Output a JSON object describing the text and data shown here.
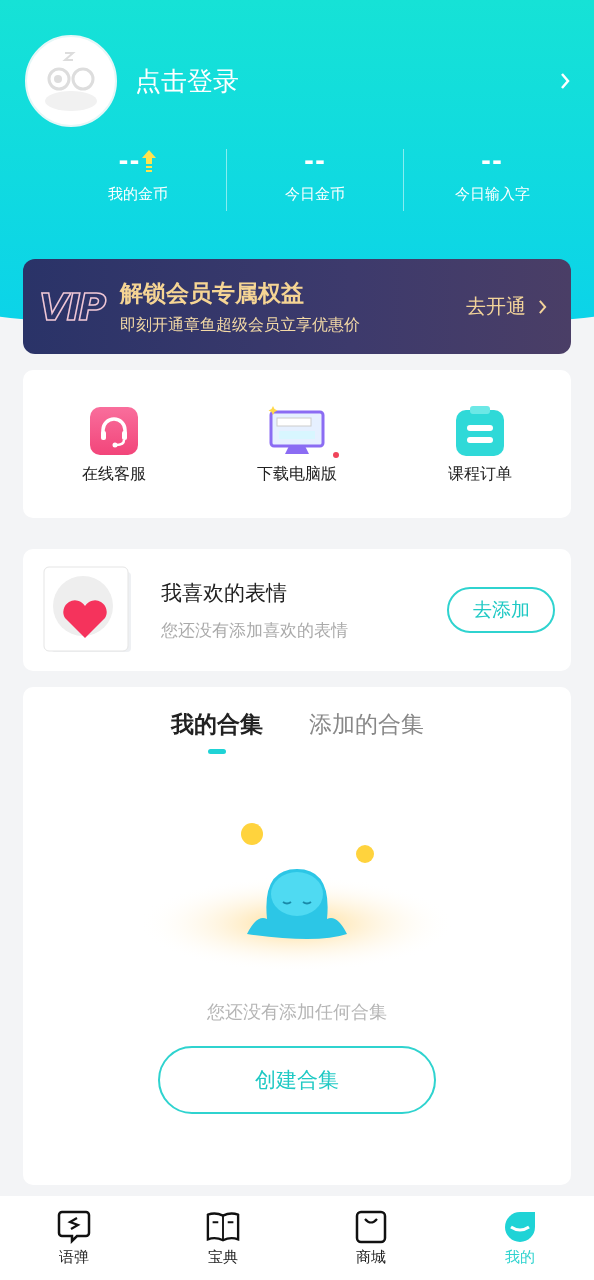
{
  "profile": {
    "login_text": "点击登录"
  },
  "stats": [
    {
      "value": "--",
      "label": "我的金币",
      "up_icon": true
    },
    {
      "value": "--",
      "label": "今日金币",
      "up_icon": false
    },
    {
      "value": "--",
      "label": "今日输入字",
      "up_icon": false
    }
  ],
  "vip": {
    "logo": "VIP",
    "title": "解锁会员专属权益",
    "subtitle": "即刻开通章鱼超级会员立享优惠价",
    "action": "去开通"
  },
  "quick_actions": [
    {
      "label": "在线客服",
      "kind": "headset",
      "dot": false
    },
    {
      "label": "下载电脑版",
      "kind": "monitor",
      "dot": true
    },
    {
      "label": "课程订单",
      "kind": "clipboard",
      "dot": false
    }
  ],
  "favorites": {
    "title": "我喜欢的表情",
    "subtitle": "您还没有添加喜欢的表情",
    "button": "去添加"
  },
  "collections": {
    "tabs": [
      {
        "label": "我的合集",
        "selected": true
      },
      {
        "label": "添加的合集",
        "selected": false
      }
    ],
    "empty_text": "您还没有添加任何合集",
    "button": "创建合集"
  },
  "nav": [
    {
      "label": "语弹",
      "kind": "chat",
      "selected": false
    },
    {
      "label": "宝典",
      "kind": "book",
      "selected": false
    },
    {
      "label": "商城",
      "kind": "bag",
      "selected": false
    },
    {
      "label": "我的",
      "kind": "me",
      "selected": true
    }
  ]
}
